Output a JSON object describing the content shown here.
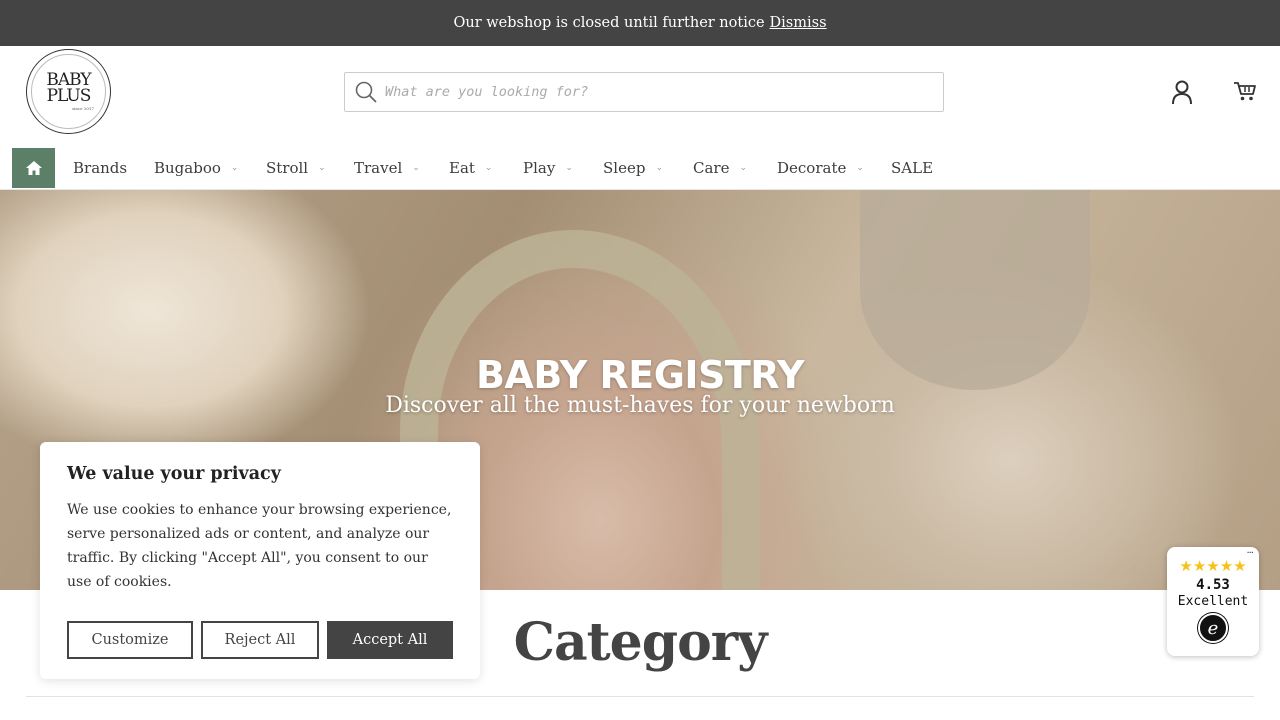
{
  "notice": {
    "text": "Our webshop is closed until further notice",
    "dismiss_label": "Dismiss"
  },
  "logo": {
    "line1": "BABY",
    "line2": "PLUS",
    "tagline": "since 2017"
  },
  "search": {
    "placeholder": "What are you looking for?"
  },
  "header": {
    "account_icon": "user-icon",
    "cart_icon": "cart-icon"
  },
  "nav": {
    "home_icon": "home-icon",
    "items": [
      {
        "label": "Brands",
        "has_dropdown": false
      },
      {
        "label": "Bugaboo",
        "has_dropdown": true
      },
      {
        "label": "Stroll",
        "has_dropdown": true
      },
      {
        "label": "Travel",
        "has_dropdown": true
      },
      {
        "label": "Eat",
        "has_dropdown": true
      },
      {
        "label": "Play",
        "has_dropdown": true
      },
      {
        "label": "Sleep",
        "has_dropdown": true
      },
      {
        "label": "Care",
        "has_dropdown": true
      },
      {
        "label": "Decorate",
        "has_dropdown": true
      },
      {
        "label": "SALE",
        "has_dropdown": false
      }
    ],
    "chevron": "⌄"
  },
  "hero": {
    "title": "BABY REGISTRY",
    "subtitle": "Discover all the must-haves for your newborn"
  },
  "category": {
    "heading": "Category"
  },
  "cookie": {
    "title": "We value your privacy",
    "body": "We use cookies to enhance your browsing experience, serve personalized ads or content, and analyze our traffic. By clicking \"Accept All\", you consent to our use of cookies.",
    "customize_label": "Customize",
    "reject_label": "Reject All",
    "accept_label": "Accept All"
  },
  "trust_badge": {
    "stars": "★★★★★",
    "rating": "4.53",
    "rating_label": "Excellent",
    "logo_letter": "e",
    "menu": "···"
  },
  "colors": {
    "notice_bg": "#444444",
    "nav_home_bg": "#5c7f67",
    "accept_bg": "#444444",
    "star": "#f6c21a"
  }
}
